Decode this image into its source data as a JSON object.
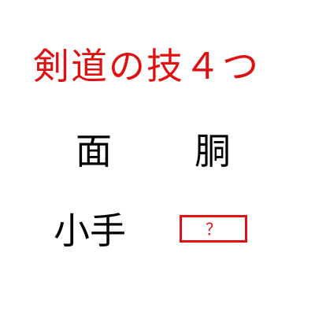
{
  "title": {
    "text": "剣道の技４つ",
    "color": "#e01010"
  },
  "terms": {
    "men": "面",
    "do": "胴",
    "kote": "小手"
  },
  "answer_box": {
    "placeholder": "？",
    "border_color": "#e01010"
  }
}
